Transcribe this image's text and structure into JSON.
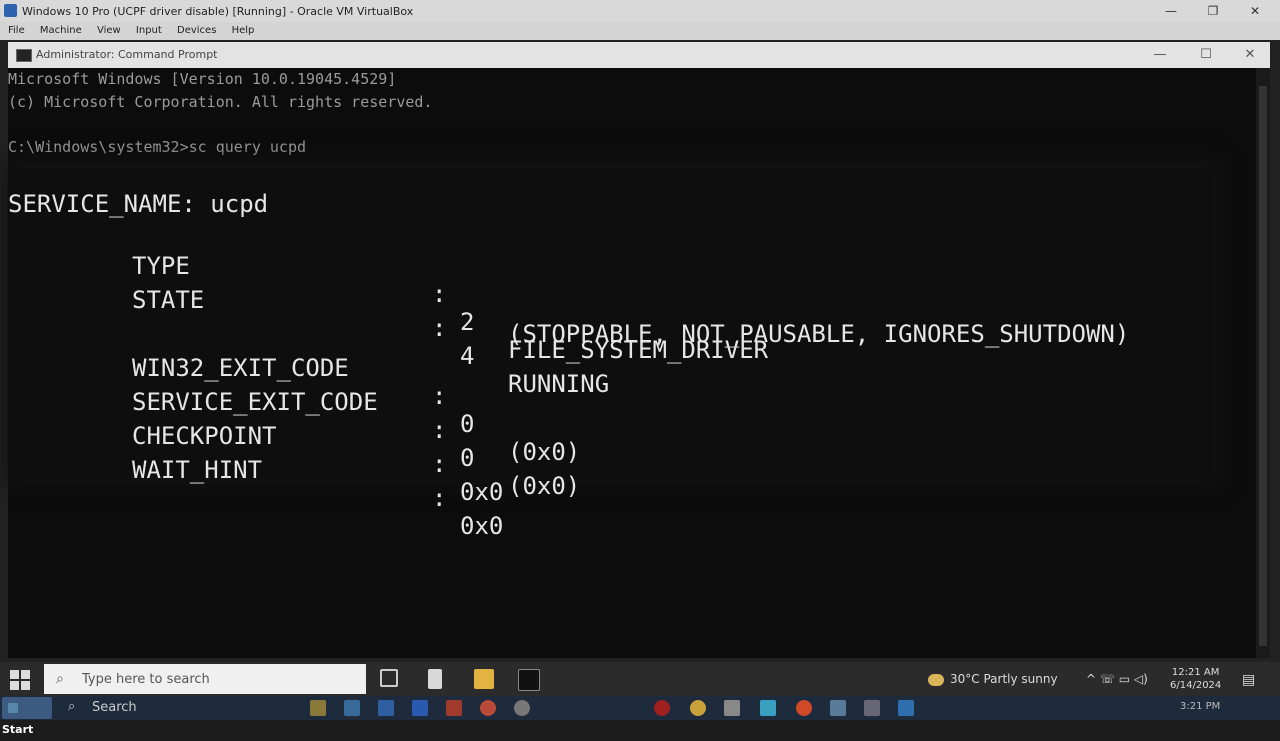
{
  "vbox": {
    "title": "Windows 10 Pro (UCPF driver disable) [Running] - Oracle VM VirtualBox",
    "menu": [
      "File",
      "Machine",
      "View",
      "Input",
      "Devices",
      "Help"
    ],
    "minimize": "—",
    "maximize": "❐",
    "close": "✕"
  },
  "cmd": {
    "title": "Administrator: Command Prompt",
    "minimize": "—",
    "maximize": "☐",
    "close": "✕",
    "lines": [
      "Microsoft Windows [Version 10.0.19045.4529]",
      "(c) Microsoft Corporation. All rights reserved.",
      "",
      "C:\\Windows\\system32>sc query ucpd"
    ],
    "service": {
      "header": "SERVICE_NAME: ucpd",
      "rows": [
        {
          "key": "TYPE",
          "colon": ":",
          "val": "2",
          "desc": "FILE_SYSTEM_DRIVER"
        },
        {
          "key": "STATE",
          "colon": ":",
          "val": "4",
          "desc": "RUNNING"
        },
        {
          "key": "",
          "colon": "",
          "val": "",
          "desc": "(STOPPABLE, NOT_PAUSABLE, IGNORES_SHUTDOWN)"
        },
        {
          "key": "WIN32_EXIT_CODE",
          "colon": ":",
          "val": "0",
          "desc": "(0x0)"
        },
        {
          "key": "SERVICE_EXIT_CODE",
          "colon": ":",
          "val": "0",
          "desc": "(0x0)"
        },
        {
          "key": "CHECKPOINT",
          "colon": ":",
          "val": "0x0",
          "desc": ""
        },
        {
          "key": "WAIT_HINT",
          "colon": ":",
          "val": "0x0",
          "desc": ""
        }
      ]
    }
  },
  "guest_taskbar": {
    "search_placeholder": "Type here to search",
    "weather": "30°C  Partly sunny",
    "tray": "^ ☏ ▭ ◁)",
    "time": "12:21 AM",
    "date": "6/14/2024",
    "notification": "▤"
  },
  "host_taskbar": {
    "start": "Start",
    "search": "Search",
    "time": "3:21 PM"
  }
}
